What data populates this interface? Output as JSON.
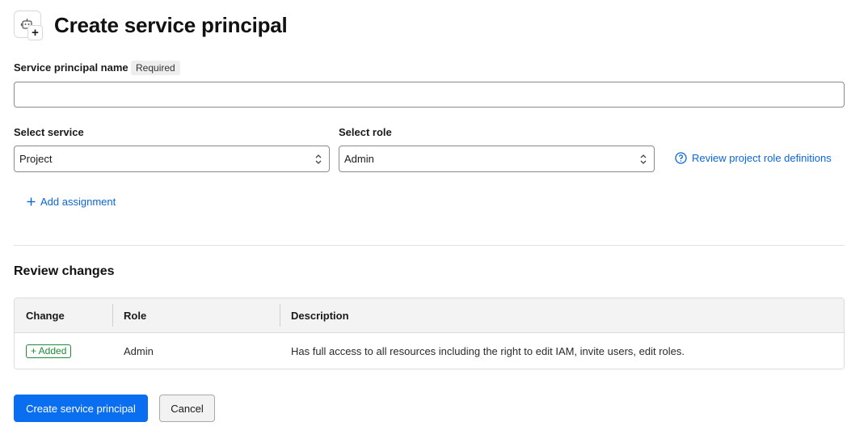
{
  "header": {
    "title": "Create service principal",
    "icon": "service-principal-icon"
  },
  "form": {
    "name_label": "Service principal name",
    "required_badge": "Required",
    "name_value": "",
    "service_label": "Select service",
    "service_value": "Project",
    "role_label": "Select role",
    "role_value": "Admin",
    "review_link": "Review project role definitions",
    "add_assignment": "Add assignment"
  },
  "review": {
    "title": "Review changes",
    "columns": [
      "Change",
      "Role",
      "Description"
    ],
    "rows": [
      {
        "change": "+ Added",
        "role": "Admin",
        "description": "Has full access to all resources including the right to edit IAM, invite users, edit roles."
      }
    ]
  },
  "actions": {
    "primary": "Create service principal",
    "secondary": "Cancel"
  },
  "colors": {
    "accent": "#0a6ef0",
    "link": "#0a66d8",
    "added": "#1f8a3a"
  }
}
